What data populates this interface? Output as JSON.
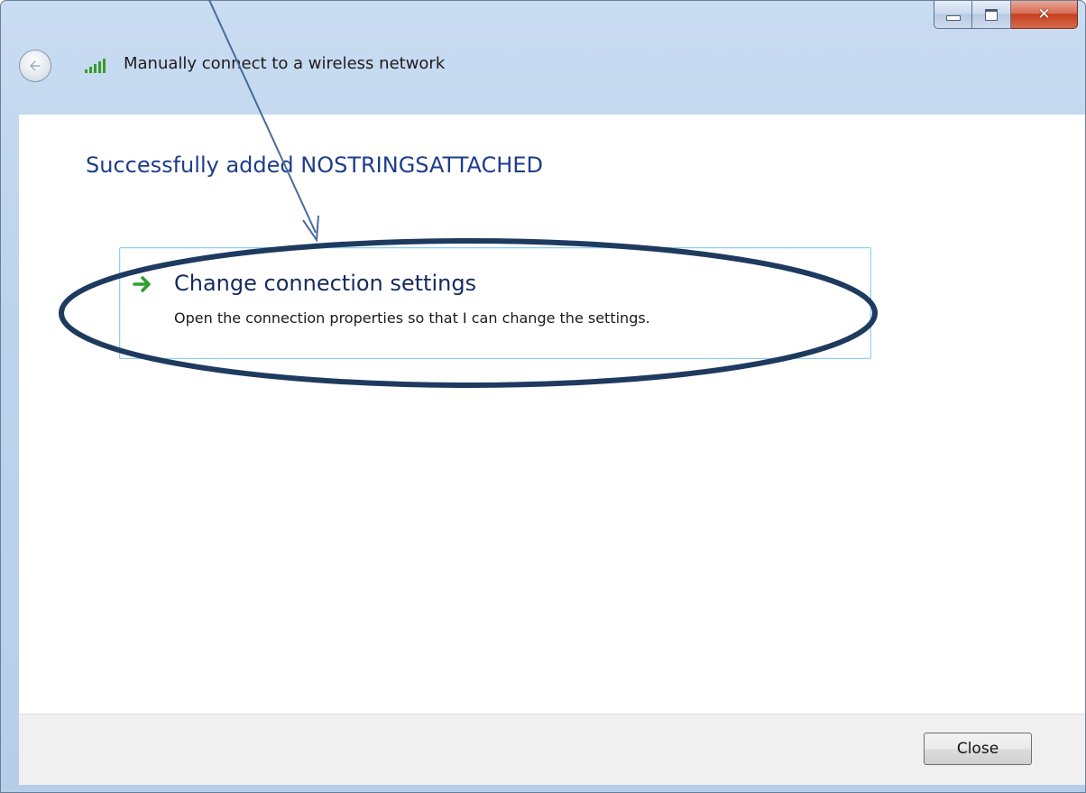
{
  "window": {
    "caption": {
      "minimize_icon": "minimize-icon",
      "maximize_icon": "maximize-icon",
      "close_glyph": "✕"
    },
    "nav": {
      "back_icon": "back-arrow-icon",
      "network_icon": "wireless-signal-icon",
      "title": "Manually connect to a wireless network"
    }
  },
  "content": {
    "headline": "Successfully added NOSTRINGSATTACHED",
    "command_link": {
      "icon": "green-arrow-icon",
      "title": "Change connection settings",
      "description": "Open the connection properties so that I can change the settings."
    }
  },
  "footer": {
    "close_label": "Close"
  },
  "colors": {
    "headline": "#1e3c8c",
    "link_border": "#8fd1ef",
    "arrow_green": "#2fa02f",
    "annotation": "#1f3a5f"
  }
}
